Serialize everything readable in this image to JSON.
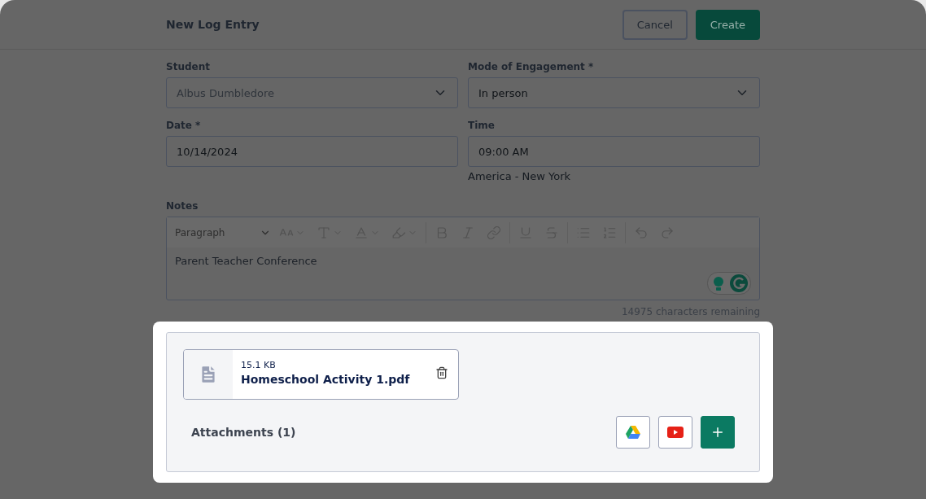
{
  "header": {
    "title": "New Log Entry",
    "buttons": [
      {
        "label": "Cancel",
        "kind": "secondary"
      },
      {
        "label": "Create",
        "kind": "primary"
      }
    ]
  },
  "fields": [
    {
      "label": "Student",
      "value": "Albus Dumbledore",
      "kind": "select",
      "disabled": true
    },
    {
      "label": "Mode of Engagement *",
      "value": "In person",
      "kind": "select",
      "disabled": false
    },
    {
      "label": "Date *",
      "value": "10/14/2024",
      "kind": "text",
      "disabled": false
    },
    {
      "label": "Time",
      "value": "09:00 AM",
      "kind": "text",
      "disabled": false,
      "hint": "America - New York"
    }
  ],
  "notes": {
    "label": "Notes",
    "block_format": "Paragraph",
    "text": "Parent Teacher Conference",
    "counter": "14975 characters remaining"
  },
  "attachments": {
    "files": [
      {
        "size": "15.1",
        "unit": "KB",
        "name": "Homeschool Activity 1.pdf"
      }
    ],
    "title": "Attachments (1)"
  }
}
